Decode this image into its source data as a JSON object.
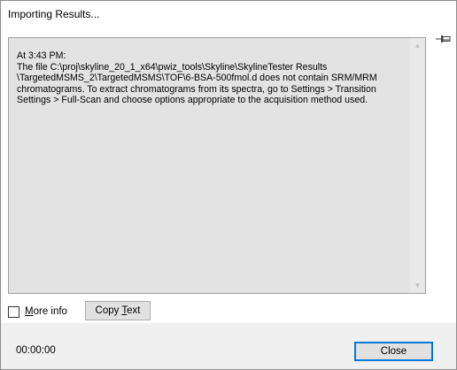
{
  "window": {
    "title": "Importing Results..."
  },
  "message": {
    "text": "At 3:43 PM:\nThe file C:\\proj\\skyline_20_1_x64\\pwiz_tools\\Skyline\\SkylineTester Results\n\\TargetedMSMS_2\\TargetedMSMS\\TOF\\6-BSA-500fmol.d does not contain SRM/MRM\nchromatograms. To extract chromatograms from its spectra, go to Settings > Transition\nSettings > Full-Scan and choose options appropriate to the acquisition method used."
  },
  "more_info": {
    "label_hotkey": "M",
    "label_rest": "ore info",
    "checked": false
  },
  "copy_button": {
    "label_prefix": "Copy ",
    "label_hotkey": "T",
    "label_rest": "ext"
  },
  "footer": {
    "elapsed_time": "00:00:00",
    "close_label": "Close"
  },
  "icons": {
    "pin": "pin-icon",
    "scroll_up": "scroll-up-arrow-icon",
    "scroll_down": "scroll-down-arrow-icon"
  }
}
